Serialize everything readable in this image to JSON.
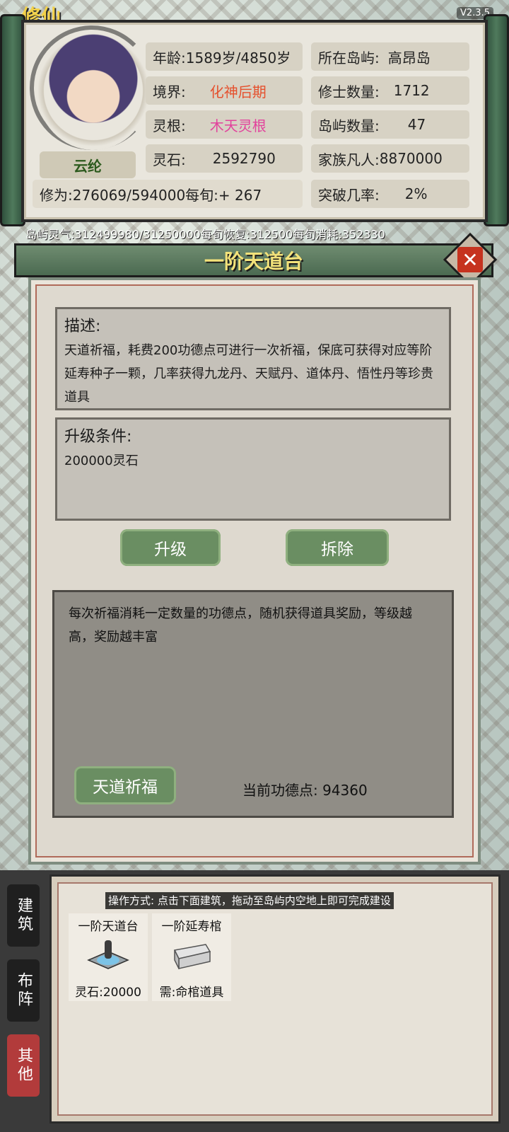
{
  "app": {
    "logo_text": "修仙",
    "version": "V2.3.5"
  },
  "player": {
    "name": "云纶",
    "age_label": "年龄:",
    "age_value": "1589岁/4850岁",
    "realm_label": "境界:",
    "realm_value": "化神后期",
    "root_label": "灵根:",
    "root_value": "木天灵根",
    "stone_label": "灵石:",
    "stone_value": "2592790",
    "cultivation_text": "修为:276069/594000每旬:+ 267",
    "island_label": "所在岛屿:",
    "island_value": "高昂岛",
    "cultivator_label": "修士数量:",
    "cultivator_value": "1712",
    "island_count_label": "岛屿数量:",
    "island_count_value": "47",
    "mortal_label": "家族凡人:",
    "mortal_value": "8870000",
    "breakthrough_label": "突破几率:",
    "breakthrough_value": "2%"
  },
  "aura_text": "岛屿灵气:312499980/31250000每旬恢复:312500每旬消耗:352330",
  "building": {
    "title": "一阶天道台",
    "description_heading": "描述:",
    "description": "天道祈福，耗费200功德点可进行一次祈福，保底可获得对应等阶延寿种子一颗，几率获得九龙丹、天赋丹、道体丹、悟性丹等珍贵道具",
    "upgrade_heading": "升级条件:",
    "upgrade_cost": "200000灵石",
    "upgrade_button": "升级",
    "demolish_button": "拆除",
    "wish_description": "每次祈福消耗一定数量的功德点，随机获得道具奖励，等级越高，奖励越丰富",
    "wish_button": "天道祈福",
    "merit_text": "当前功德点: 94360",
    "close_icon": "close-icon"
  },
  "build_menu": {
    "tabs": [
      {
        "label": "建筑",
        "active": false
      },
      {
        "label": "布阵",
        "active": false
      },
      {
        "label": "其他",
        "active": true
      }
    ],
    "hint": "操作方式: 点击下面建筑，拖动至岛屿内空地上即可完成建设",
    "items": [
      {
        "name": "一阶天道台",
        "cost": "灵石:20000",
        "icon": "altar-icon"
      },
      {
        "name": "一阶延寿棺",
        "cost": "需:命棺道具",
        "icon": "coffin-icon"
      }
    ]
  },
  "colors": {
    "accent_green": "#6a8e62",
    "title_yellow": "#f3e27a",
    "realm_red": "#e5512e",
    "root_pink": "#e2429c"
  }
}
